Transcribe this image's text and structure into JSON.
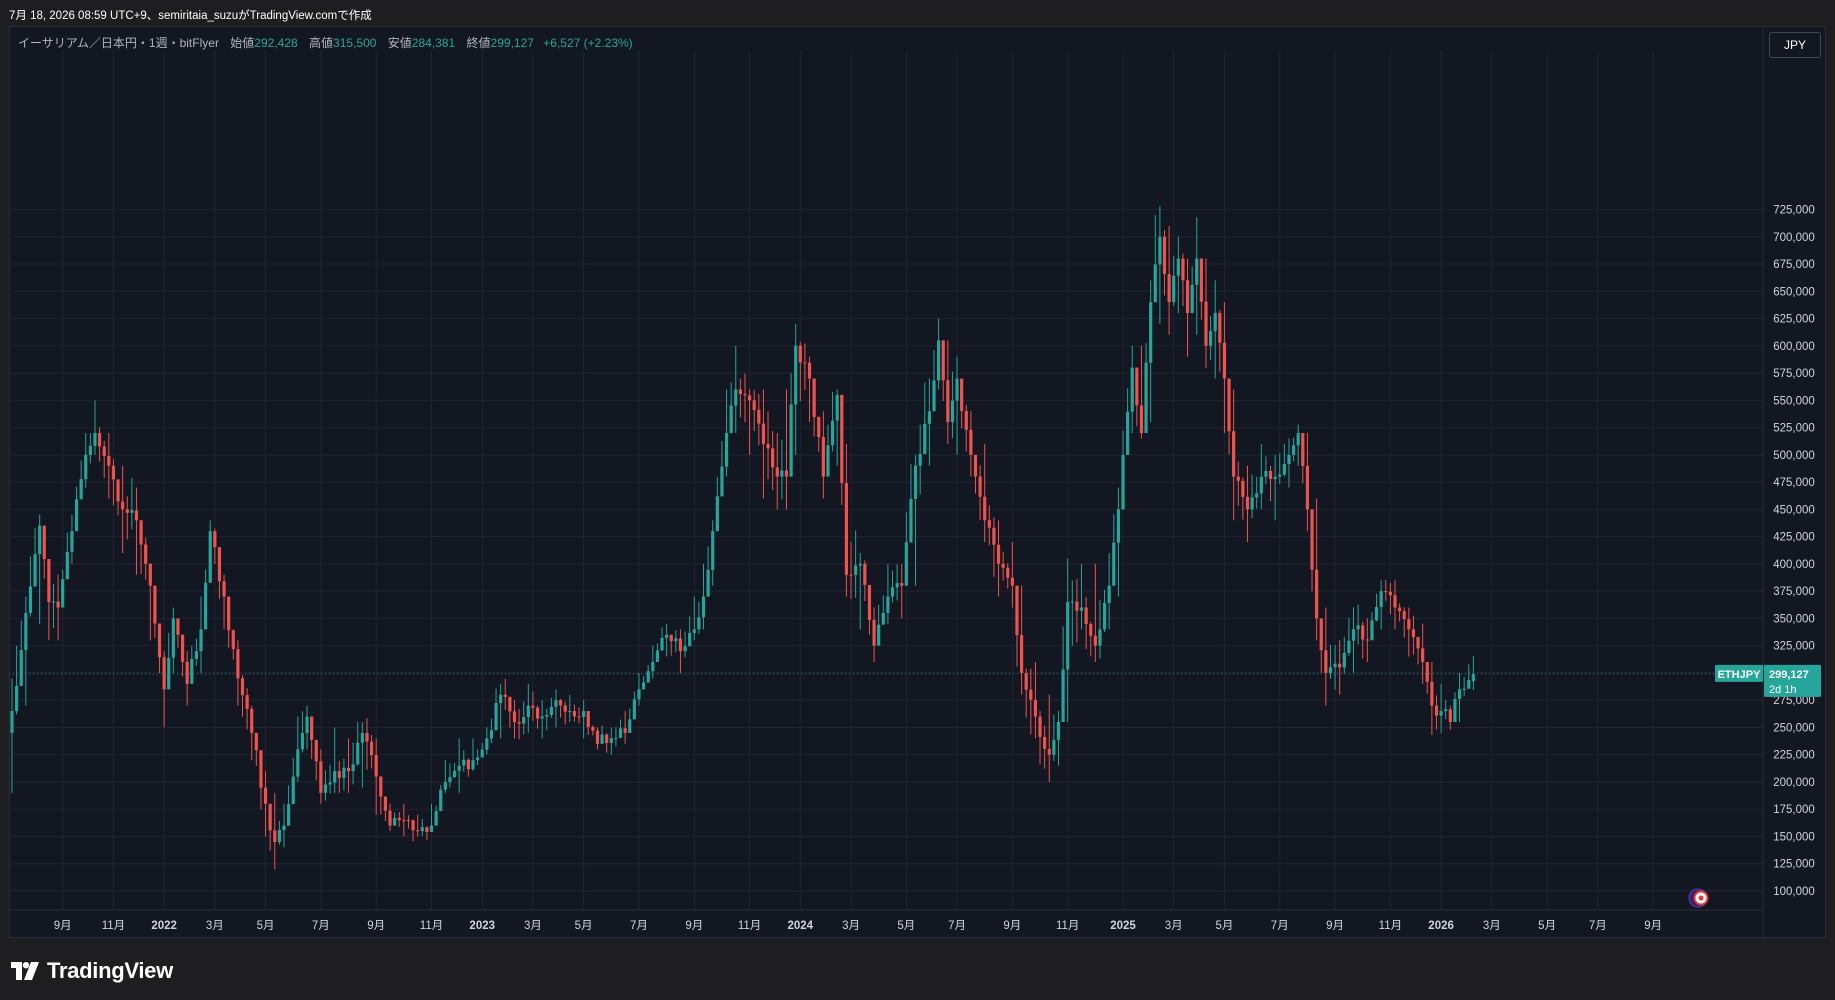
{
  "header": {
    "caption": "7月 18, 2026 08:59 UTC+9、semiritaia_suzuがTradingView.comで作成"
  },
  "legend": {
    "symbol": "イーサリアム／日本円・1週・bitFlyer",
    "open_label": "始値",
    "open": "292,428",
    "high_label": "高値",
    "high": "315,500",
    "low_label": "安値",
    "low": "284,381",
    "close_label": "終値",
    "close": "299,127",
    "change": "+6,527 (+2.23%)"
  },
  "currency_button": "JPY",
  "price_tag": {
    "symbol": "ETHJPY",
    "price": "299,127",
    "countdown": "2d 1h"
  },
  "footer": {
    "brand": "TradingView"
  },
  "colors": {
    "up": "#26a69a",
    "down": "#ef5350",
    "background": "#131722",
    "grid": "#1f2431",
    "axis_text": "#d1d4dc"
  },
  "chart_data": {
    "type": "candlestick",
    "timeframe": "1W",
    "y_axis": {
      "min": 88000,
      "max": 735000,
      "ticks": [
        100000,
        125000,
        150000,
        175000,
        200000,
        225000,
        250000,
        275000,
        300000,
        325000,
        350000,
        375000,
        400000,
        425000,
        450000,
        475000,
        500000,
        525000,
        550000,
        575000,
        600000,
        625000,
        650000,
        675000,
        700000,
        725000
      ],
      "tick_labels": [
        "100,000",
        "125,000",
        "150,000",
        "175,000",
        "200,000",
        "225,000",
        "250,000",
        "275,000",
        "300,000",
        "325,000",
        "350,000",
        "375,000",
        "400,000",
        "425,000",
        "450,000",
        "475,000",
        "500,000",
        "525,000",
        "550,000",
        "575,000",
        "600,000",
        "625,000",
        "650,000",
        "675,000",
        "700,000",
        "725,000"
      ]
    },
    "x_axis": {
      "labels": [
        "9月",
        "11月",
        "2022",
        "3月",
        "5月",
        "7月",
        "9月",
        "11月",
        "2023",
        "3月",
        "5月",
        "7月",
        "9月",
        "11月",
        "2024",
        "3月",
        "5月",
        "7月",
        "9月",
        "11月",
        "2025",
        "3月",
        "5月",
        "7月",
        "9月",
        "11月",
        "2026",
        "3月",
        "5月",
        "7月",
        "9月"
      ],
      "label_bar_index": [
        11,
        22,
        33,
        44,
        55,
        67,
        79,
        91,
        102,
        113,
        124,
        136,
        148,
        160,
        171,
        182,
        194,
        205,
        217,
        229,
        241,
        252,
        263,
        275,
        287,
        299,
        310,
        321,
        333,
        344,
        356
      ]
    },
    "last_price": 299127,
    "anchors": [
      {
        "i": 0,
        "c": 265000,
        "hi": 295000,
        "lo": 190000
      },
      {
        "i": 3,
        "c": 355000,
        "hi": 370000,
        "lo": 270000
      },
      {
        "i": 6,
        "c": 435000,
        "hi": 445000,
        "lo": 345000
      },
      {
        "i": 8,
        "c": 365000,
        "hi": 400000,
        "lo": 330000
      },
      {
        "i": 10,
        "c": 360000,
        "hi": 390000,
        "lo": 330000
      },
      {
        "i": 13,
        "c": 430000,
        "hi": 445000,
        "lo": 400000
      },
      {
        "i": 16,
        "c": 500000,
        "hi": 520000,
        "lo": 470000
      },
      {
        "i": 18,
        "c": 520000,
        "hi": 550000,
        "lo": 500000
      },
      {
        "i": 21,
        "c": 490000,
        "hi": 520000,
        "lo": 460000
      },
      {
        "i": 24,
        "c": 450000,
        "hi": 490000,
        "lo": 410000
      },
      {
        "i": 27,
        "c": 440000,
        "hi": 470000,
        "lo": 390000
      },
      {
        "i": 30,
        "c": 380000,
        "hi": 400000,
        "lo": 330000
      },
      {
        "i": 33,
        "c": 285000,
        "hi": 320000,
        "lo": 250000
      },
      {
        "i": 35,
        "c": 350000,
        "hi": 360000,
        "lo": 300000
      },
      {
        "i": 38,
        "c": 290000,
        "hi": 320000,
        "lo": 270000
      },
      {
        "i": 41,
        "c": 340000,
        "hi": 370000,
        "lo": 300000
      },
      {
        "i": 43,
        "c": 430000,
        "hi": 440000,
        "lo": 390000
      },
      {
        "i": 46,
        "c": 370000,
        "hi": 390000,
        "lo": 340000
      },
      {
        "i": 49,
        "c": 295000,
        "hi": 330000,
        "lo": 270000
      },
      {
        "i": 52,
        "c": 245000,
        "hi": 270000,
        "lo": 220000
      },
      {
        "i": 55,
        "c": 180000,
        "hi": 210000,
        "lo": 150000
      },
      {
        "i": 57,
        "c": 145000,
        "hi": 190000,
        "lo": 120000
      },
      {
        "i": 59,
        "c": 160000,
        "hi": 180000,
        "lo": 140000
      },
      {
        "i": 62,
        "c": 230000,
        "hi": 260000,
        "lo": 200000
      },
      {
        "i": 64,
        "c": 260000,
        "hi": 270000,
        "lo": 230000
      },
      {
        "i": 67,
        "c": 190000,
        "hi": 230000,
        "lo": 180000
      },
      {
        "i": 70,
        "c": 210000,
        "hi": 250000,
        "lo": 190000
      },
      {
        "i": 73,
        "c": 210000,
        "hi": 240000,
        "lo": 190000
      },
      {
        "i": 76,
        "c": 245000,
        "hi": 255000,
        "lo": 195000
      },
      {
        "i": 79,
        "c": 205000,
        "hi": 240000,
        "lo": 170000
      },
      {
        "i": 82,
        "c": 160000,
        "hi": 180000,
        "lo": 155000
      },
      {
        "i": 85,
        "c": 165000,
        "hi": 180000,
        "lo": 150000
      },
      {
        "i": 88,
        "c": 155000,
        "hi": 170000,
        "lo": 150000
      },
      {
        "i": 91,
        "c": 160000,
        "hi": 180000,
        "lo": 155000
      },
      {
        "i": 94,
        "c": 200000,
        "hi": 220000,
        "lo": 190000
      },
      {
        "i": 97,
        "c": 215000,
        "hi": 240000,
        "lo": 190000
      },
      {
        "i": 100,
        "c": 220000,
        "hi": 240000,
        "lo": 210000
      },
      {
        "i": 103,
        "c": 240000,
        "hi": 250000,
        "lo": 225000
      },
      {
        "i": 106,
        "c": 280000,
        "hi": 290000,
        "lo": 240000
      },
      {
        "i": 109,
        "c": 255000,
        "hi": 275000,
        "lo": 240000
      },
      {
        "i": 112,
        "c": 270000,
        "hi": 290000,
        "lo": 245000
      },
      {
        "i": 115,
        "c": 260000,
        "hi": 275000,
        "lo": 240000
      },
      {
        "i": 118,
        "c": 275000,
        "hi": 285000,
        "lo": 250000
      },
      {
        "i": 121,
        "c": 265000,
        "hi": 280000,
        "lo": 255000
      },
      {
        "i": 124,
        "c": 265000,
        "hi": 275000,
        "lo": 240000
      },
      {
        "i": 127,
        "c": 235000,
        "hi": 250000,
        "lo": 230000
      },
      {
        "i": 130,
        "c": 240000,
        "hi": 250000,
        "lo": 225000
      },
      {
        "i": 133,
        "c": 245000,
        "hi": 265000,
        "lo": 235000
      },
      {
        "i": 136,
        "c": 285000,
        "hi": 300000,
        "lo": 270000
      },
      {
        "i": 139,
        "c": 310000,
        "hi": 325000,
        "lo": 295000
      },
      {
        "i": 142,
        "c": 335000,
        "hi": 345000,
        "lo": 315000
      },
      {
        "i": 145,
        "c": 320000,
        "hi": 340000,
        "lo": 300000
      },
      {
        "i": 148,
        "c": 340000,
        "hi": 370000,
        "lo": 330000
      },
      {
        "i": 150,
        "c": 370000,
        "hi": 400000,
        "lo": 340000
      },
      {
        "i": 152,
        "c": 430000,
        "hi": 440000,
        "lo": 380000
      },
      {
        "i": 155,
        "c": 520000,
        "hi": 560000,
        "lo": 480000
      },
      {
        "i": 157,
        "c": 560000,
        "hi": 600000,
        "lo": 520000
      },
      {
        "i": 160,
        "c": 550000,
        "hi": 560000,
        "lo": 500000
      },
      {
        "i": 163,
        "c": 510000,
        "hi": 560000,
        "lo": 460000
      },
      {
        "i": 166,
        "c": 480000,
        "hi": 520000,
        "lo": 450000
      },
      {
        "i": 168,
        "c": 480000,
        "hi": 560000,
        "lo": 450000
      },
      {
        "i": 170,
        "c": 600000,
        "hi": 620000,
        "lo": 500000
      },
      {
        "i": 173,
        "c": 570000,
        "hi": 590000,
        "lo": 530000
      },
      {
        "i": 176,
        "c": 480000,
        "hi": 540000,
        "lo": 460000
      },
      {
        "i": 179,
        "c": 555000,
        "hi": 560000,
        "lo": 490000
      },
      {
        "i": 181,
        "c": 390000,
        "hi": 510000,
        "lo": 370000
      },
      {
        "i": 184,
        "c": 400000,
        "hi": 410000,
        "lo": 340000
      },
      {
        "i": 187,
        "c": 325000,
        "hi": 360000,
        "lo": 310000
      },
      {
        "i": 190,
        "c": 370000,
        "hi": 400000,
        "lo": 345000
      },
      {
        "i": 193,
        "c": 380000,
        "hi": 400000,
        "lo": 350000
      },
      {
        "i": 196,
        "c": 490000,
        "hi": 500000,
        "lo": 380000
      },
      {
        "i": 199,
        "c": 540000,
        "hi": 570000,
        "lo": 490000
      },
      {
        "i": 201,
        "c": 605000,
        "hi": 625000,
        "lo": 560000
      },
      {
        "i": 203,
        "c": 530000,
        "hi": 605000,
        "lo": 510000
      },
      {
        "i": 205,
        "c": 570000,
        "hi": 590000,
        "lo": 500000
      },
      {
        "i": 208,
        "c": 500000,
        "hi": 540000,
        "lo": 480000
      },
      {
        "i": 211,
        "c": 440000,
        "hi": 510000,
        "lo": 420000
      },
      {
        "i": 214,
        "c": 400000,
        "hi": 440000,
        "lo": 370000
      },
      {
        "i": 217,
        "c": 380000,
        "hi": 420000,
        "lo": 360000
      },
      {
        "i": 219,
        "c": 300000,
        "hi": 380000,
        "lo": 280000
      },
      {
        "i": 222,
        "c": 260000,
        "hi": 310000,
        "lo": 240000
      },
      {
        "i": 225,
        "c": 225000,
        "hi": 280000,
        "lo": 200000
      },
      {
        "i": 227,
        "c": 255000,
        "hi": 265000,
        "lo": 215000
      },
      {
        "i": 229,
        "c": 365000,
        "hi": 405000,
        "lo": 255000
      },
      {
        "i": 232,
        "c": 360000,
        "hi": 400000,
        "lo": 340000
      },
      {
        "i": 235,
        "c": 325000,
        "hi": 400000,
        "lo": 310000
      },
      {
        "i": 238,
        "c": 380000,
        "hi": 410000,
        "lo": 340000
      },
      {
        "i": 240,
        "c": 450000,
        "hi": 470000,
        "lo": 370000
      },
      {
        "i": 243,
        "c": 580000,
        "hi": 600000,
        "lo": 520000
      },
      {
        "i": 245,
        "c": 520000,
        "hi": 600000,
        "lo": 515000
      },
      {
        "i": 247,
        "c": 640000,
        "hi": 660000,
        "lo": 530000
      },
      {
        "i": 249,
        "c": 700000,
        "hi": 728000,
        "lo": 620000
      },
      {
        "i": 251,
        "c": 640000,
        "hi": 710000,
        "lo": 610000
      },
      {
        "i": 253,
        "c": 680000,
        "hi": 700000,
        "lo": 630000
      },
      {
        "i": 255,
        "c": 630000,
        "hi": 680000,
        "lo": 590000
      },
      {
        "i": 257,
        "c": 680000,
        "hi": 718000,
        "lo": 610000
      },
      {
        "i": 259,
        "c": 600000,
        "hi": 680000,
        "lo": 580000
      },
      {
        "i": 261,
        "c": 630000,
        "hi": 660000,
        "lo": 570000
      },
      {
        "i": 263,
        "c": 570000,
        "hi": 640000,
        "lo": 520000
      },
      {
        "i": 265,
        "c": 480000,
        "hi": 560000,
        "lo": 440000
      },
      {
        "i": 268,
        "c": 450000,
        "hi": 490000,
        "lo": 420000
      },
      {
        "i": 271,
        "c": 480000,
        "hi": 510000,
        "lo": 450000
      },
      {
        "i": 274,
        "c": 480000,
        "hi": 500000,
        "lo": 440000
      },
      {
        "i": 277,
        "c": 500000,
        "hi": 515000,
        "lo": 470000
      },
      {
        "i": 279,
        "c": 520000,
        "hi": 528000,
        "lo": 490000
      },
      {
        "i": 281,
        "c": 450000,
        "hi": 520000,
        "lo": 430000
      },
      {
        "i": 283,
        "c": 350000,
        "hi": 460000,
        "lo": 330000
      },
      {
        "i": 285,
        "c": 300000,
        "hi": 360000,
        "lo": 270000
      },
      {
        "i": 288,
        "c": 305000,
        "hi": 330000,
        "lo": 280000
      },
      {
        "i": 291,
        "c": 340000,
        "hi": 360000,
        "lo": 300000
      },
      {
        "i": 294,
        "c": 330000,
        "hi": 350000,
        "lo": 310000
      },
      {
        "i": 297,
        "c": 375000,
        "hi": 385000,
        "lo": 340000
      },
      {
        "i": 300,
        "c": 360000,
        "hi": 385000,
        "lo": 340000
      },
      {
        "i": 303,
        "c": 340000,
        "hi": 360000,
        "lo": 315000
      },
      {
        "i": 306,
        "c": 310000,
        "hi": 345000,
        "lo": 290000
      },
      {
        "i": 308,
        "c": 270000,
        "hi": 310000,
        "lo": 243000
      },
      {
        "i": 310,
        "c": 265000,
        "hi": 290000,
        "lo": 245000
      },
      {
        "i": 312,
        "c": 255000,
        "hi": 270000,
        "lo": 248000
      },
      {
        "i": 314,
        "c": 285000,
        "hi": 300000,
        "lo": 255000
      },
      {
        "i": 317,
        "c": 299127,
        "hi": 315500,
        "lo": 284381
      }
    ]
  }
}
